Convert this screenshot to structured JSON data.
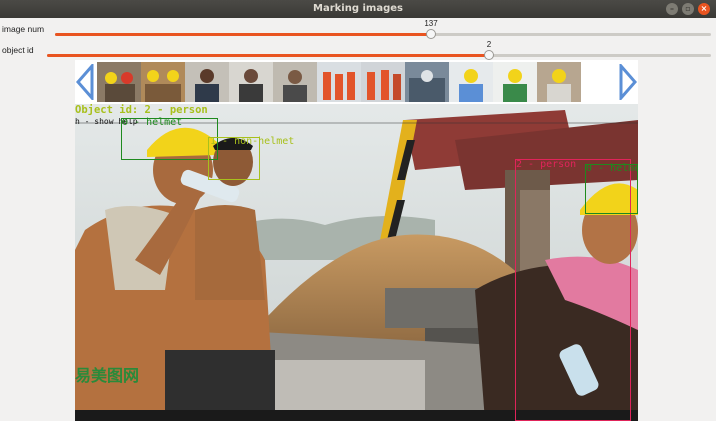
{
  "window": {
    "title": "Marking images"
  },
  "sliders": {
    "image_num": {
      "label": "image num",
      "value": "137"
    },
    "object_id": {
      "label": "object id",
      "value": "2"
    }
  },
  "overlay": {
    "object_id_text": "Object id: 2  - person",
    "help_text": "h - show help"
  },
  "annotations": [
    {
      "label": "0 - helmet",
      "color": "#1e8a1e"
    },
    {
      "label": "1 - non-helmet",
      "color": "#a8c01c"
    },
    {
      "label": "2 - person",
      "color": "#e0245a"
    },
    {
      "label": "0 - helmet",
      "color": "#1e8a1e"
    }
  ],
  "watermark": "易美图网",
  "colors": {
    "accent": "#e95420",
    "helmet": "#1e8a1e",
    "non_helmet": "#a8c01c",
    "person": "#e0245a",
    "nav_arrow": "#5b8fd6"
  }
}
